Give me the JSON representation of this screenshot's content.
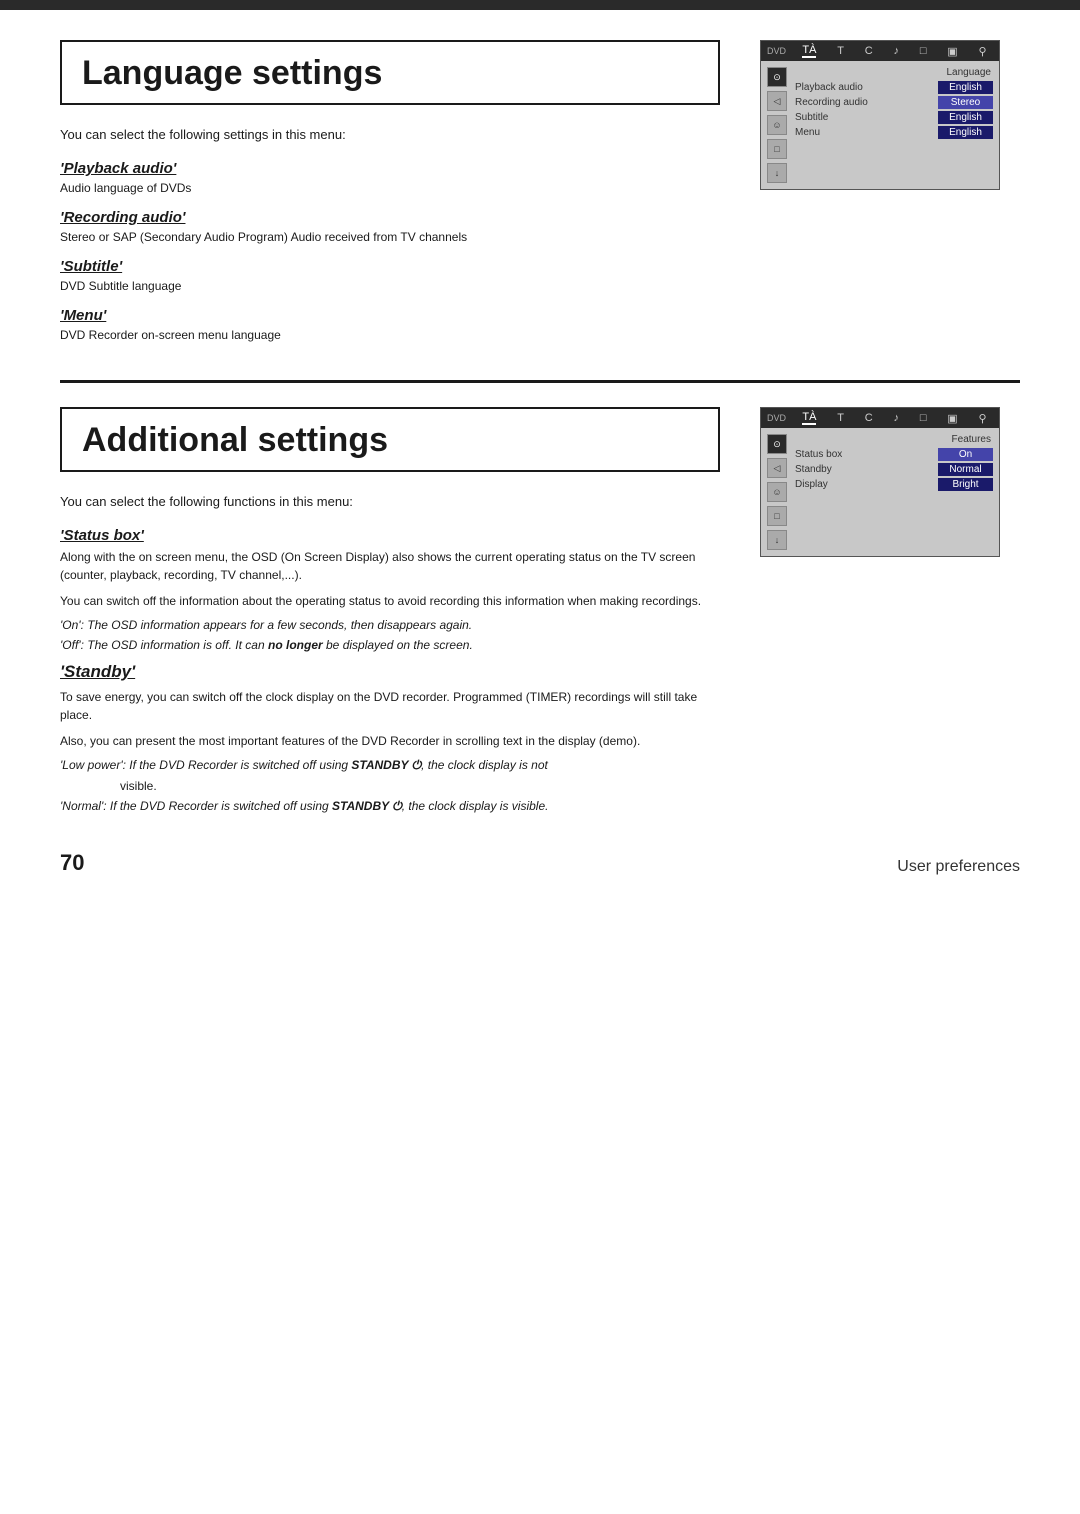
{
  "top_bar": {},
  "language_section": {
    "title": "Language settings",
    "intro": "You can select the following settings in this menu:",
    "subsections": [
      {
        "title": "'Playback audio'",
        "desc": "Audio language of DVDs"
      },
      {
        "title": "'Recording audio'",
        "desc": "Stereo or SAP (Secondary Audio Program) Audio received from TV channels"
      },
      {
        "title": "'Subtitle'",
        "desc": "DVD Subtitle language"
      },
      {
        "title": "'Menu'",
        "desc": "DVD Recorder on-screen menu language"
      }
    ],
    "menu_mockup": {
      "header_label": "Language",
      "rows": [
        {
          "label": "Playback audio",
          "value": "English"
        },
        {
          "label": "Recording audio",
          "value": "Stereo"
        },
        {
          "label": "Subtitle",
          "value": "English"
        },
        {
          "label": "Menu",
          "value": "English"
        }
      ]
    }
  },
  "additional_section": {
    "title": "Additional settings",
    "intro": "You can select the following functions in this menu:",
    "status_box": {
      "title": "'Status box'",
      "paragraphs": [
        "Along with the on screen menu, the OSD (On Screen Display) also shows the current operating status on the TV screen (counter, playback, recording, TV channel,...).",
        "You can switch off the information about the operating status to avoid recording this information when making recordings."
      ],
      "on_note": "'On':  The OSD information appears for a few seconds, then disappears again.",
      "off_note_prefix": "'Off':  The OSD information is off. It can ",
      "off_note_bold": "no longer",
      "off_note_suffix": " be displayed on the screen."
    },
    "standby": {
      "title": "'Standby'",
      "paragraphs": [
        "To save energy, you can switch off the clock display on the DVD recorder. Programmed (TIMER) recordings will still take place.",
        "Also, you can present the most important features of the DVD Recorder in scrolling text in the display (demo)."
      ],
      "low_power_prefix": "'Low power':  If the DVD Recorder is switched off using ",
      "low_power_standby": "STANDBY ⏻",
      "low_power_suffix": ", the clock display is not",
      "low_power_indent": "visible.",
      "normal_prefix": "'Normal':  If the DVD Recorder is switched off using ",
      "normal_standby": "STANDBY ⏻",
      "normal_suffix": ", the clock display is visible."
    },
    "menu_mockup": {
      "header_label": "Features",
      "rows": [
        {
          "label": "Status box",
          "value": "On"
        },
        {
          "label": "Standby",
          "value": "Normal"
        },
        {
          "label": "Display",
          "value": "Bright"
        }
      ]
    }
  },
  "footer": {
    "page_number": "70",
    "section_label": "User preferences"
  },
  "icons": {
    "top_bar_icons": [
      "TÀ",
      "T",
      "C",
      "♪",
      "□",
      "▣",
      "⚲"
    ]
  }
}
